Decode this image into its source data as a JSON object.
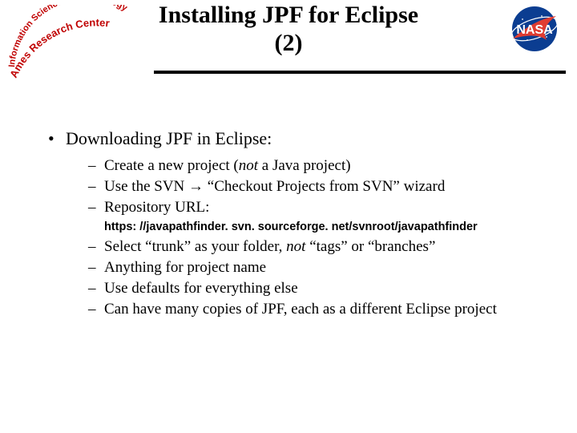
{
  "header": {
    "title_line1": "Installing JPF for Eclipse",
    "title_line2": "(2)",
    "ames_text_top": "Information Sciences & Technology",
    "ames_text_bottom": "Ames Research Center",
    "nasa_text": "NASA"
  },
  "body": {
    "heading": "Downloading JPF in Eclipse:",
    "items_a": {
      "i0_pre": "Create a new project (",
      "i0_em": "not",
      "i0_post": " a Java project)",
      "i1_pre": "Use the SVN ",
      "i1_arrow": "→",
      "i1_post": " “Checkout Projects from SVN” wizard",
      "i2": "Repository URL:"
    },
    "url": "https: //javapathfinder. svn. sourceforge. net/svnroot/javapathfinder",
    "items_b": {
      "i0_pre": "Select “trunk” as your folder, ",
      "i0_em": "not",
      "i0_post": " “tags” or “branches”",
      "i1": "Anything for project name",
      "i2": "Use defaults for everything else",
      "i3": "Can have many copies of JPF, each as a different Eclipse project"
    }
  }
}
